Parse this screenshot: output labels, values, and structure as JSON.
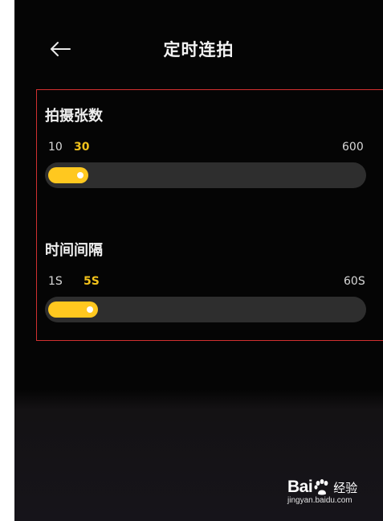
{
  "header": {
    "title": "定时连拍"
  },
  "sections": [
    {
      "label": "拍摄张数",
      "min_label": "10",
      "current_label": "30",
      "max_label": "600",
      "value": 30,
      "min": 10,
      "max": 600
    },
    {
      "label": "时间间隔",
      "min_label": "1S",
      "current_label": "5S",
      "max_label": "60S",
      "value": 5,
      "min": 1,
      "max": 60
    }
  ],
  "watermark": {
    "brand_left": "Bai",
    "brand_right": "经验",
    "url": "jingyan.baidu.com"
  },
  "colors": {
    "accent": "#ffc81f",
    "highlight_border": "#d23030",
    "track": "#2e2e2e",
    "background": "#050505"
  },
  "icons": {
    "back": "arrow-left-icon",
    "watermark": "baidu-paw-icon"
  }
}
